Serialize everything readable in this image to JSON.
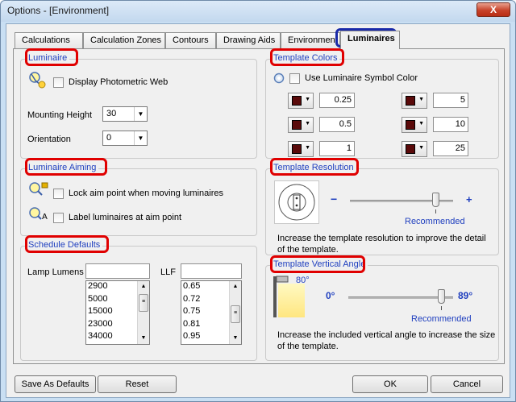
{
  "window": {
    "title": "Options - [Environment]",
    "close_glyph": "X"
  },
  "tabs": [
    {
      "label": "Calculations"
    },
    {
      "label": "Calculation Zones"
    },
    {
      "label": "Contours"
    },
    {
      "label": "Drawing Aids"
    },
    {
      "label": "Environment"
    },
    {
      "label": "Luminaires",
      "active": true
    }
  ],
  "luminaire": {
    "group_label": "Luminaire",
    "display_photometric_web": "Display Photometric Web",
    "mounting_height_label": "Mounting Height",
    "mounting_height_value": "30",
    "orientation_label": "Orientation",
    "orientation_value": "0"
  },
  "aiming": {
    "group_label": "Luminaire Aiming",
    "lock_aim": "Lock aim point when moving luminaires",
    "label_aim": "Label luminaires at aim point"
  },
  "schedule": {
    "group_label": "Schedule Defaults",
    "lamp_lumens_label": "Lamp Lumens",
    "llf_label": "LLF",
    "lamp_lumens_input": "",
    "llf_input": "",
    "lumens": [
      "2900",
      "5000",
      "15000",
      "23000",
      "34000"
    ],
    "llf": [
      "0.65",
      "0.72",
      "0.75",
      "0.81",
      "0.95"
    ]
  },
  "template_colors": {
    "group_label": "Template Colors",
    "use_symbol_color": "Use Luminaire Symbol Color",
    "left_values": [
      "0.25",
      "0.5",
      "1"
    ],
    "right_values": [
      "5",
      "10",
      "25"
    ],
    "swatch_color": "#5a0a0a"
  },
  "template_resolution": {
    "group_label": "Template Resolution",
    "minus": "−",
    "plus": "+",
    "recommended": "Recommended",
    "description": "Increase the template resolution to improve the detail of the template."
  },
  "template_angle": {
    "group_label": "Template Vertical Angle",
    "preview_angle": "80°",
    "min_label": "0°",
    "max_label": "89°",
    "recommended": "Recommended",
    "description": "Increase the included vertical angle to increase the size of the template."
  },
  "footer": {
    "save_defaults": "Save As Defaults",
    "reset": "Reset",
    "ok": "OK",
    "cancel": "Cancel"
  }
}
